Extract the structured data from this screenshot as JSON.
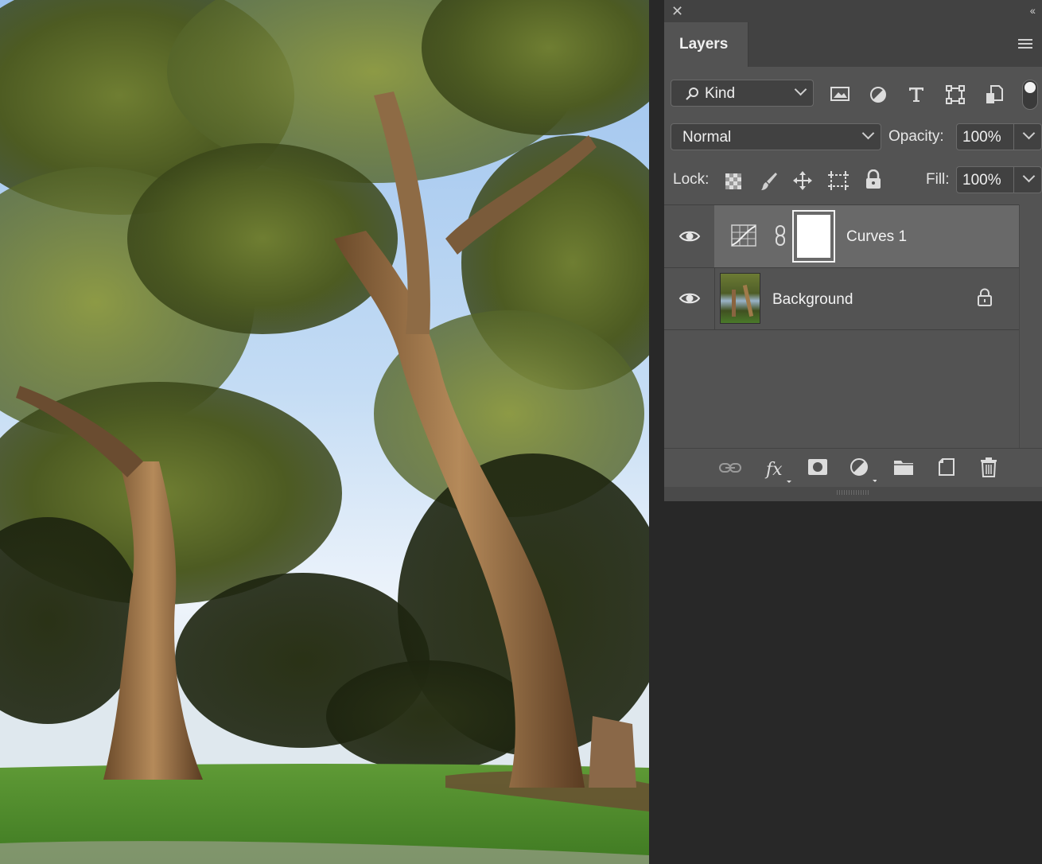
{
  "panel": {
    "tab_title": "Layers",
    "close_glyph": "✕",
    "collapse_glyph": "‹‹",
    "filter": {
      "value": "Kind"
    },
    "blend_mode": {
      "value": "Normal"
    },
    "opacity": {
      "label": "Opacity:",
      "value": "100%"
    },
    "lock": {
      "label": "Lock:"
    },
    "fill": {
      "label": "Fill:",
      "value": "100%"
    },
    "layers": [
      {
        "name": "Curves 1",
        "selected": true,
        "type": "adjustment-curves"
      },
      {
        "name": "Background",
        "selected": false,
        "type": "image",
        "locked": true
      }
    ]
  },
  "colors": {
    "panel_bg": "#535353",
    "selected_row": "#696969",
    "workspace_bg": "#282828"
  }
}
